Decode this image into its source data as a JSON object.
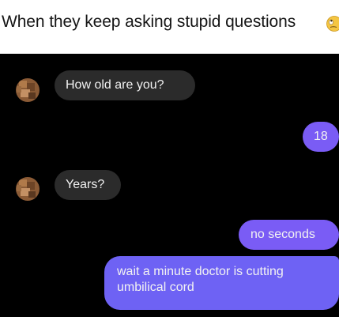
{
  "caption": {
    "text": "When they keep asking stupid questions",
    "emoji_icon": "face-with-rolling-eyes-emoji"
  },
  "chat": {
    "messages": [
      {
        "direction": "received",
        "text": "How old are you?"
      },
      {
        "direction": "sent",
        "text": "18"
      },
      {
        "direction": "received",
        "text": "Years?"
      },
      {
        "direction": "sent",
        "text": "no seconds"
      },
      {
        "direction": "sent",
        "text": "wait a minute doctor is cutting umbilical cord"
      }
    ]
  },
  "colors": {
    "chat_background": "#000000",
    "received_bubble": "#2b2b2b",
    "sent_bubble": "#7a5cf5",
    "sent_bubble_last": "#6e62f4",
    "bubble_text": "#f2f2f2",
    "caption_text": "#151515"
  }
}
